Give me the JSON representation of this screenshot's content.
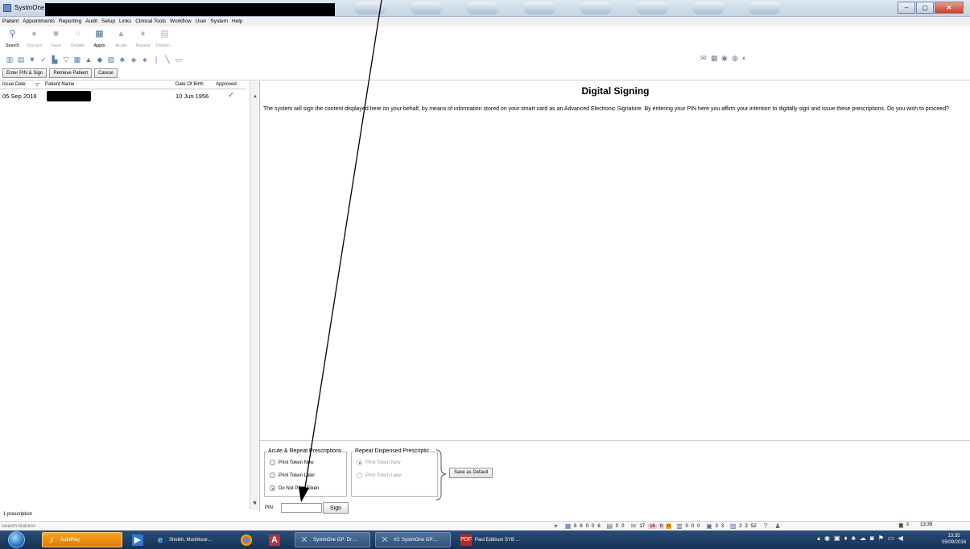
{
  "titlebar": {
    "title": "SystmOne GP"
  },
  "menubar": [
    "Patient",
    "Appointments",
    "Reporting",
    "Audit",
    "Setup",
    "Links",
    "Clinical Tools",
    "Workflow",
    "User",
    "System",
    "Help"
  ],
  "toolbar": {
    "buttons": [
      {
        "label": "Search",
        "icon": "search-icon"
      },
      {
        "label": "Discard",
        "icon": "discard-icon"
      },
      {
        "label": "Save",
        "icon": "save-icon"
      },
      {
        "label": "Details",
        "icon": "details-icon"
      },
      {
        "label": "Appts",
        "icon": "appointments-icon"
      },
      {
        "label": "Acute",
        "icon": "acute-icon"
      },
      {
        "label": "Repeat",
        "icon": "repeat-icon"
      },
      {
        "label": "Dispen...",
        "icon": "dispense-icon"
      }
    ]
  },
  "actions": {
    "enter_pin_sign": "Enter PIN & Sign",
    "retrieve_patient": "Retrieve Patient",
    "cancel": "Cancel"
  },
  "list": {
    "headers": {
      "issue_date": "Issue Date",
      "sort_indicator": "▽",
      "patient_name": "Patient Name",
      "dob": "Date Of Birth",
      "approved": "Approved"
    },
    "rows": [
      {
        "issue_date": "05 Sep 2016",
        "dob": "10 Jun 1956",
        "approved": "✓"
      }
    ],
    "footer": "1 prescription"
  },
  "signing": {
    "title": "Digital Signing",
    "text": "The system will sign the content displayed here on your behalf, by means of information stored on your smart card as an Advanced Electronic Signature. By entering your PIN here you affirm your intention to digitally sign and issue these prescriptions. Do you wish to proceed?"
  },
  "acute_group": {
    "title": "Acute & Repeat Prescriptions",
    "options": [
      "Print Token Now",
      "Print Token Later",
      "Do Not Print Token"
    ],
    "selected": "Do Not Print Token"
  },
  "dispensed_group": {
    "title": "Repeat Dispensed Prescriptic",
    "options": [
      "Print Token Now",
      "Print Token Later"
    ],
    "selected": "Print Token Now"
  },
  "save_default": "Save as Default",
  "pin": {
    "label": "PIN",
    "value": "",
    "sign": "Sign"
  },
  "searchbar": {
    "placeholder": "Search features"
  },
  "status_counts": [
    "6",
    "6",
    "0",
    "0",
    "6",
    "0",
    "0",
    "17",
    "16",
    "0",
    "0",
    "0",
    "0",
    "0",
    "3",
    "3",
    "2",
    "2",
    "52"
  ],
  "status_time": "13:39",
  "taskbar": {
    "items": [
      "AutoPlay",
      "Sheikh, Mushkoor...",
      "SystmOne GP: Dr ...",
      "#2: SystmOne GP:...",
      "Paul Eddison SYB ..."
    ],
    "time": "13:35",
    "date": "05/09/2016"
  },
  "colors": {
    "approved_tick": "#4ea02c",
    "taskbar": "#1f3f66",
    "badge_pink": "#f6c6d8",
    "badge_orange": "#f7a93b"
  }
}
